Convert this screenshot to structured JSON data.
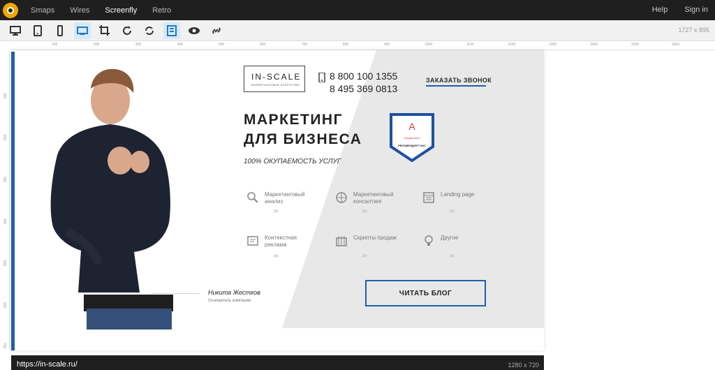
{
  "app": {
    "nav": [
      "Smaps",
      "Wires",
      "Screenfly",
      "Retro"
    ],
    "active_nav": "Screenfly",
    "right_links": [
      "Help",
      "Sign in"
    ],
    "screen_size_label": "1727 x 895"
  },
  "toolbar": {
    "tools": [
      "desktop-icon",
      "tablet-icon",
      "mobile-icon",
      "screen-icon",
      "crop-icon",
      "refresh-icon",
      "rotate-icon",
      "layout-icon",
      "eye-icon",
      "link-icon"
    ],
    "active_tools": [
      "screen-icon",
      "layout-icon"
    ]
  },
  "ruler": {
    "top_ticks": [
      "100",
      "200",
      "300",
      "400",
      "500",
      "600",
      "700",
      "800",
      "900",
      "1000",
      "1100",
      "1200",
      "1300",
      "1400",
      "1500",
      "1600"
    ],
    "left_ticks": [
      "100",
      "200",
      "300",
      "400",
      "500",
      "600",
      "700"
    ]
  },
  "site": {
    "brand_main": "IN-SCALE",
    "brand_sub": "МАРКЕТИНГОВОЕ АГЕНТСТВО",
    "phone1": "8 800 100 1355",
    "phone2": "8 495 369 0813",
    "call_cta": "ЗАКАЗАТЬ ЗВОНОК",
    "headline_line1": "МАРКЕТИНГ",
    "headline_line2": "ДЛЯ БИЗНЕСА",
    "tagline": "100% ОКУПАЕМОСТЬ УСЛУГ",
    "badge_top": "Альфа-Банк",
    "badge_bottom": "РЕКОМЕНДУЕТ НАС",
    "services": [
      {
        "label": "Маркетинговый анализ",
        "icon": "analysis-icon"
      },
      {
        "label": "Маркетинговый консалтинг",
        "icon": "consulting-icon"
      },
      {
        "label": "Landing page",
        "icon": "landing-icon"
      },
      {
        "label": "Контекстная реклама",
        "icon": "ads-icon"
      },
      {
        "label": "Скрипты продаж",
        "icon": "scripts-icon"
      },
      {
        "label": "Другое",
        "icon": "idea-icon"
      }
    ],
    "author_name": "Никита Жестков",
    "author_role": "Основатель компании",
    "blog_cta": "ЧИТАТЬ БЛОГ"
  },
  "status": {
    "url": "https://in-scale.ru/",
    "viewport": "1280 x 720"
  },
  "colors": {
    "accent_blue": "#1f5fb1",
    "dark_bar": "#1f1f1f",
    "grey_panel": "#e8e8e8",
    "badge_red": "#d63b2e"
  }
}
